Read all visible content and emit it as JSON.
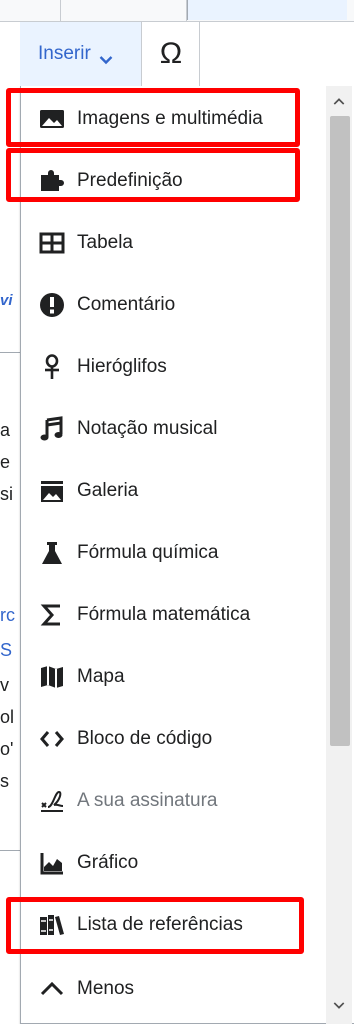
{
  "toolbar": {
    "insert_label": "Inserir",
    "special_char_label": "Ω"
  },
  "menu": {
    "items": [
      {
        "label": "Imagens e multimédia",
        "icon": "image-icon"
      },
      {
        "label": "Predefinição",
        "icon": "puzzle-icon"
      },
      {
        "label": "Tabela",
        "icon": "table-icon"
      },
      {
        "label": "Comentário",
        "icon": "alert-icon"
      },
      {
        "label": "Hieróglifos",
        "icon": "ankh-icon"
      },
      {
        "label": "Notação musical",
        "icon": "music-note-icon"
      },
      {
        "label": "Galeria",
        "icon": "gallery-icon"
      },
      {
        "label": "Fórmula química",
        "icon": "flask-icon"
      },
      {
        "label": "Fórmula matemática",
        "icon": "sigma-icon"
      },
      {
        "label": "Mapa",
        "icon": "map-icon"
      },
      {
        "label": "Bloco de código",
        "icon": "code-icon"
      },
      {
        "label": "A sua assinatura",
        "icon": "signature-icon",
        "disabled": true
      },
      {
        "label": "Gráfico",
        "icon": "chart-icon"
      },
      {
        "label": "Lista de referências",
        "icon": "books-icon"
      },
      {
        "label": "Menos",
        "icon": "chevron-up-icon"
      }
    ]
  },
  "background_fragments": {
    "f1": "vi",
    "f2": "a",
    "f3": "e",
    "f4": "si",
    "f5": "rc",
    "f6": "S",
    "f7": "v",
    "f8": "ol",
    "f9": "o'",
    "f10": "s"
  },
  "annotation_color": "#ff0000",
  "accent_color": "#3366cc"
}
